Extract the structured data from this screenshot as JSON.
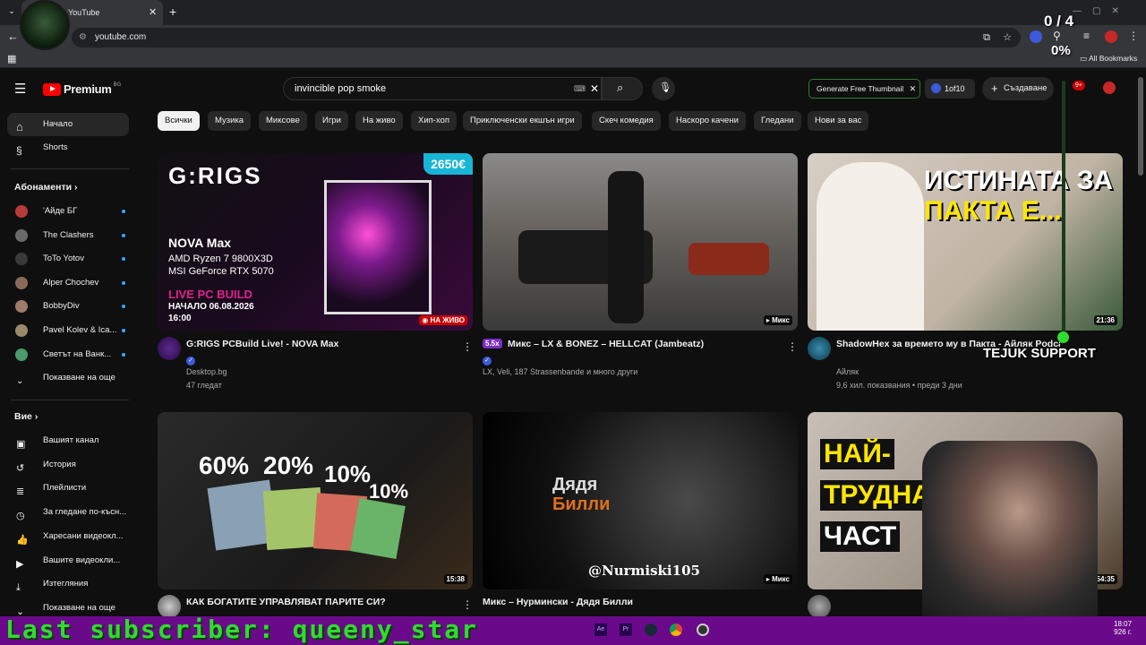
{
  "browser": {
    "tab_title": "YouTube",
    "url": "youtube.com",
    "bookmarks_label": "All Bookmarks",
    "clock": "18:07",
    "tray_sub": "926 г."
  },
  "header": {
    "brand": "Premium",
    "region": "BG",
    "search_value": "invincible pop smoke",
    "extension_label": "Generate Free Thumbnail",
    "counter_label": "1of10",
    "create_label": "Създаване",
    "notif_badge": "9+"
  },
  "chips": [
    "Всички",
    "Музика",
    "Миксове",
    "Игри",
    "На живо",
    "Хип-хоп",
    "Приключенски екшън игри",
    "Скеч комедия",
    "Наскоро качени",
    "Гледани",
    "Нови за вас"
  ],
  "sidebar": {
    "home": "Начало",
    "shorts": "Shorts",
    "subscriptions_header": "Абонаменти",
    "subscriptions": [
      "'Айде БГ",
      "The Clashers",
      "ToTo Yotov",
      "Alper Chochev",
      "BobbyDiv",
      "Pavel Kolev & Ica...",
      "Светът на Ванк..."
    ],
    "show_more": "Показване на още",
    "you_header": "Вие",
    "you_items": [
      "Вашият канал",
      "История",
      "Плейлисти",
      "За гледане по-късн...",
      "Харесани видеокл...",
      "Вашите видеокли...",
      "Изтегляния",
      "Показване на още"
    ]
  },
  "videos": [
    {
      "title": "G:RIGS PCBuild Live! - NOVA Max",
      "channel": "Desktop.bg",
      "meta": "47 гледат",
      "badge": "НА ЖИВО",
      "thumb_text": [
        "G:RIGS",
        "NOVA Max",
        "AMD Ryzen 7 9800X3D",
        "MSI GeForce RTX 5070",
        "LIVE PC BUILD",
        "НАЧАЛО 06.08.2026",
        "16:00"
      ],
      "price": "2650€"
    },
    {
      "title": "Микс – LX & BONEZ – HELLCAT (Jambeatz)",
      "channel": "LX, Veli, 187 Strassenbande и много други",
      "meta": "",
      "badge": "Микс",
      "prefix": "5.5x"
    },
    {
      "title": "ShadowHex за времето му в Пакта - Айляк Podcast",
      "channel": "Айляк",
      "meta": "9,6 хил. показвания • преди 3 дни",
      "badge": "21:36",
      "thumb_text": [
        "ИСТИНАТА ЗА",
        "ПАКТА Е..."
      ]
    },
    {
      "title": "КАК БОГАТИТЕ УПРАВЛЯВАТ ПАРИТЕ СИ?",
      "channel": "",
      "meta": "",
      "badge": "15:38",
      "thumb_text": [
        "60%",
        "20%",
        "10%",
        "10%"
      ]
    },
    {
      "title": "Микс – Нурмински - Дядя Билли",
      "channel": "",
      "meta": "",
      "badge": "Микс",
      "thumb_text": [
        "Дядя",
        "Билли",
        "@Nurmiski105"
      ]
    },
    {
      "title": "",
      "channel": "",
      "meta": "",
      "badge": "54:35",
      "thumb_text": [
        "НАЙ-",
        "ТРУДНАТ",
        "ЧАСТ"
      ]
    }
  ],
  "overlay": {
    "counter": "0 / 4",
    "percent": "0%",
    "support": "TEJUK SUPPORT",
    "last_sub": "Last subscriber: queeny_star"
  }
}
